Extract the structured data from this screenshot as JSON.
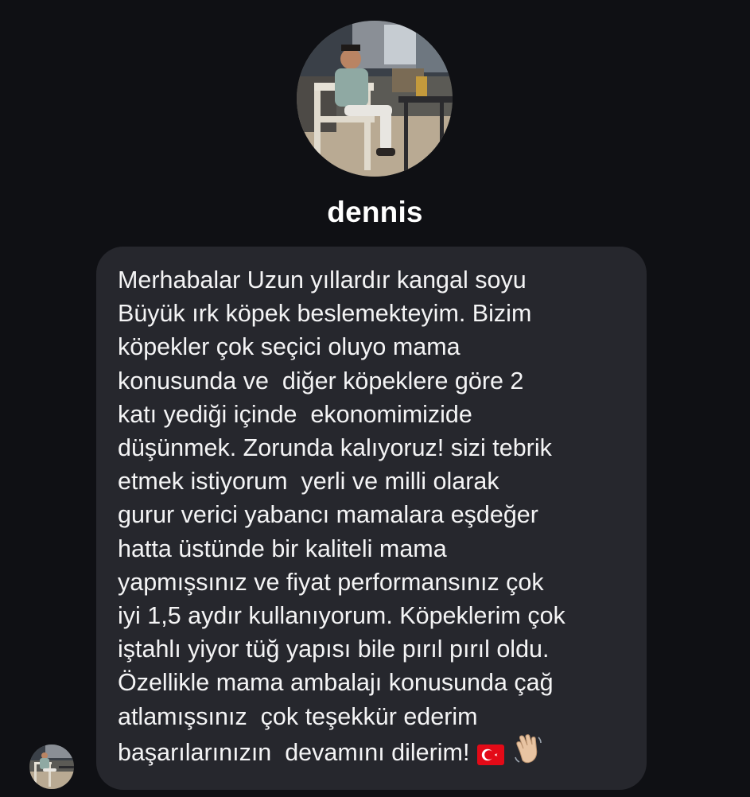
{
  "profile": {
    "username": "dennis"
  },
  "message": {
    "lines": [
      "Merhabalar Uzun yıllardır kangal soyu",
      "Büyük ırk köpek beslemekteyim. Bizim",
      "köpekler çok seçici oluyo mama",
      "konusunda ve  diğer köpeklere göre 2",
      "katı yediği içinde  ekonomimizide",
      "düşünmek. Zorunda kalıyoruz! sizi tebrik",
      "etmek istiyorum  yerli ve milli olarak",
      "gurur verici yabancı mamalara eşdeğer",
      "hatta üstünde bir kaliteli mama",
      "yapmışsınız ve fiyat performansınız çok",
      "iyi 1,5 aydır kullanıyorum. Köpeklerim çok",
      "iştahlı yiyor tüğ yapısı bile pırıl pırıl oldu.",
      "Özellikle mama ambalajı konusunda çağ",
      "atlamışsınız  çok teşekkür ederim",
      "başarılarınızın  devamını dilerim!"
    ],
    "emojis": [
      "turkey-flag",
      "waving-hand"
    ]
  },
  "colors": {
    "background": "#0f1014",
    "bubble": "#26272d",
    "text": "#f4f4f5",
    "flag_red": "#e30a17"
  }
}
